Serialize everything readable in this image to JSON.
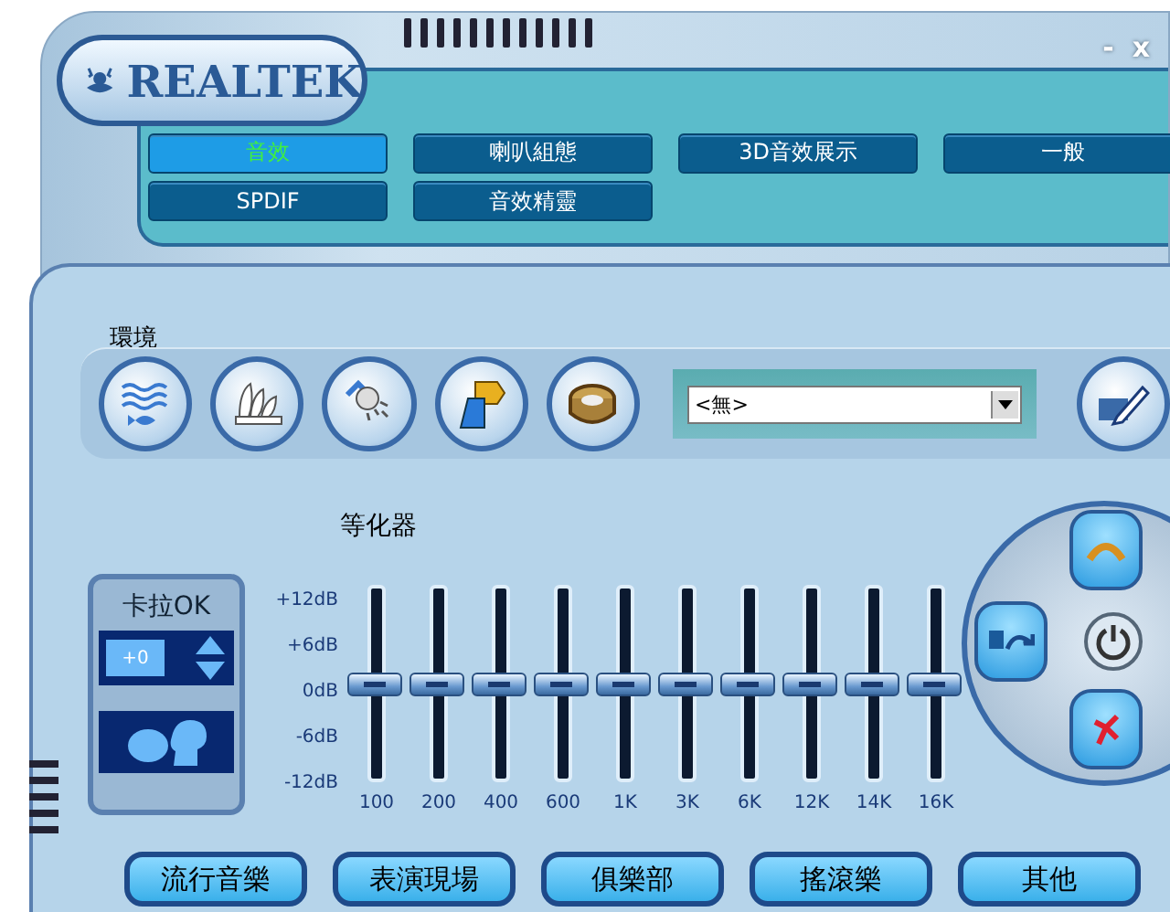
{
  "window": {
    "logo": "REALTEK",
    "controls": [
      "-",
      "x"
    ]
  },
  "tabs": [
    {
      "label": "音效",
      "selected": true
    },
    {
      "label": "喇叭組態",
      "selected": false
    },
    {
      "label": "3D音效展示",
      "selected": false
    },
    {
      "label": "一般",
      "selected": false
    },
    {
      "label": "SPDIF",
      "selected": false
    },
    {
      "label": "音效精靈",
      "selected": false
    }
  ],
  "environment": {
    "label": "環境",
    "buttons": [
      {
        "kind": "underwater"
      },
      {
        "kind": "opera"
      },
      {
        "kind": "shower"
      },
      {
        "kind": "pipe"
      },
      {
        "kind": "colosseum"
      }
    ],
    "dropdown": {
      "value": "<無>"
    }
  },
  "equalizer": {
    "label": "等化器",
    "scale": [
      "+12dB",
      "+6dB",
      "0dB",
      "-6dB",
      "-12dB"
    ],
    "bands": [
      {
        "label": "100",
        "level": 0.5
      },
      {
        "label": "200",
        "level": 0.5
      },
      {
        "label": "400",
        "level": 0.5
      },
      {
        "label": "600",
        "level": 0.5
      },
      {
        "label": "1K",
        "level": 0.5
      },
      {
        "label": "3K",
        "level": 0.5
      },
      {
        "label": "6K",
        "level": 0.5
      },
      {
        "label": "12K",
        "level": 0.5
      },
      {
        "label": "14K",
        "level": 0.5
      },
      {
        "label": "16K",
        "level": 0.5
      }
    ]
  },
  "karaoke": {
    "title": "卡拉OK",
    "value": "+0"
  },
  "presets": [
    "流行音樂",
    "表演現場",
    "俱樂部",
    "搖滾樂",
    "其他"
  ]
}
